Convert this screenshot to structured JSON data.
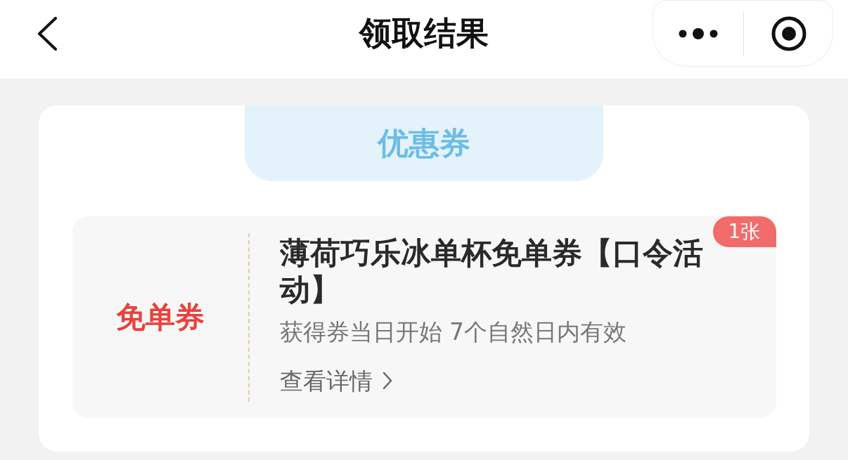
{
  "header": {
    "title": "领取结果"
  },
  "section_tab": {
    "label": "优惠券"
  },
  "coupon": {
    "type_label": "免单券",
    "badge": "1张",
    "title": "薄荷巧乐冰单杯免单券【口令活动】",
    "validity": "获得券当日开始 7个自然日内有效",
    "details_link": "查看详情"
  }
}
